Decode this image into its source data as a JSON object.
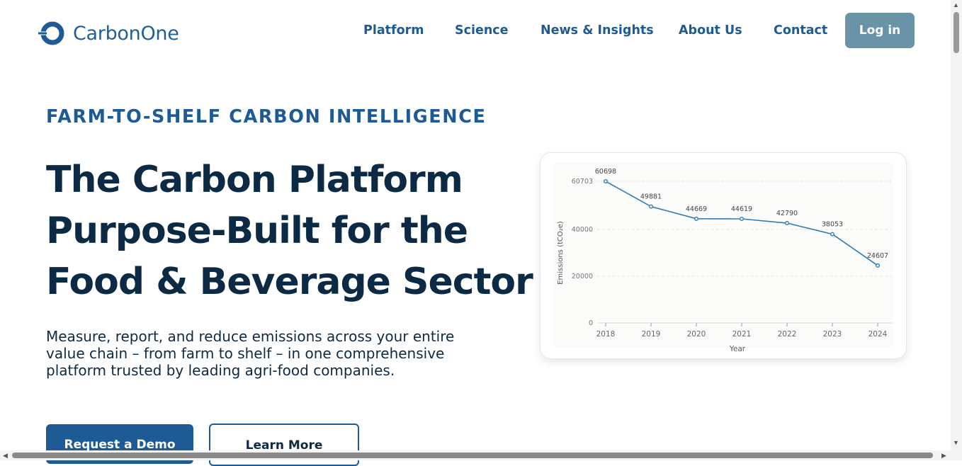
{
  "brand": {
    "name": "CarbonOne"
  },
  "nav": {
    "items": [
      "Platform",
      "Science",
      "News & Insights",
      "About Us",
      "Contact"
    ],
    "login_label": "Log in"
  },
  "hero": {
    "eyebrow": "FARM-TO-SHELF CARBON INTELLIGENCE",
    "headline_lines": [
      "The Carbon Platform",
      "Purpose-Built for the",
      "Food & Beverage Sector"
    ],
    "subtext": "Measure, report, and reduce emissions across your entire value chain – from farm to shelf – in one comprehensive platform trusted by leading agri-food companies.",
    "cta_primary": "Request a Demo",
    "cta_secondary": "Learn More"
  },
  "colors": {
    "brand_blue": "#1e5b94",
    "heading_navy": "#0d2a44",
    "login_button": "#6a93a7",
    "chart_line": "#2f7bb5"
  },
  "icons": {
    "logo": "carbonone-ring-logo",
    "scroll_up": "triangle-up",
    "scroll_down": "triangle-down",
    "scroll_left": "triangle-left",
    "scroll_right": "triangle-right"
  },
  "chart_data": {
    "type": "line",
    "title": "",
    "xlabel": "Year",
    "ylabel": "Emissions (tCO₂e)",
    "x": [
      "2018",
      "2019",
      "2020",
      "2021",
      "2022",
      "2023",
      "2024"
    ],
    "series": [
      {
        "values": [
          60698,
          49881,
          44669,
          44619,
          42790,
          38053,
          24607
        ]
      }
    ],
    "ylim": [
      0,
      60703
    ],
    "yticks": [
      0,
      20000,
      40000,
      60703
    ],
    "data_labels": true,
    "grid": "horizontal-dashed",
    "legend": "none"
  }
}
